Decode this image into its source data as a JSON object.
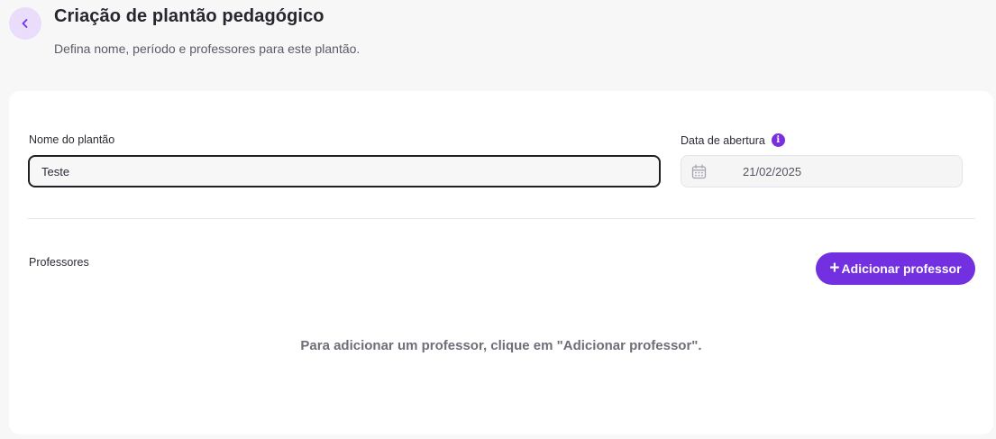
{
  "header": {
    "title": "Criação de plantão pedagógico",
    "subtitle": "Defina nome, período e professores para este plantão."
  },
  "form": {
    "name_label": "Nome do plantão",
    "name_value": "Teste",
    "date_label": "Data de abertura",
    "date_value": "21/02/2025"
  },
  "teachers": {
    "label": "Professores",
    "add_button_label": "Adicionar professor",
    "empty_message": "Para adicionar um professor, clique em \"Adicionar professor\"."
  },
  "icons": {
    "back": "chevron-left-icon",
    "info": "info-icon",
    "calendar": "calendar-icon",
    "plus": "plus-icon"
  },
  "colors": {
    "accent": "#7330e0",
    "back_button_bg": "#e9ddfb",
    "info_icon": "#7b2fdc"
  }
}
